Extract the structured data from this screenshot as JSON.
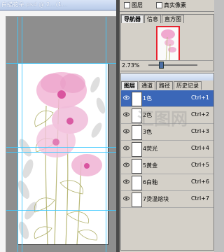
{
  "document": {
    "title": "白描花朵.psd @ 2...(1..."
  },
  "toolbar": {
    "checkbox1_label": "图层",
    "checkbox2_label": "真实像素"
  },
  "navigator": {
    "tabs": [
      "导航器",
      "信息",
      "直方图"
    ],
    "zoom": "2.73%"
  },
  "layers_panel": {
    "tabs": [
      "图层",
      "通道",
      "路径",
      "历史记录"
    ],
    "layers": [
      {
        "name": "1色",
        "shortcut": "Ctrl+1",
        "selected": true
      },
      {
        "name": "2色",
        "shortcut": "Ctrl+2",
        "selected": false
      },
      {
        "name": "3色",
        "shortcut": "Ctrl+3",
        "selected": false
      },
      {
        "name": "4荧光",
        "shortcut": "Ctrl+4",
        "selected": false
      },
      {
        "name": "5黄金",
        "shortcut": "Ctrl+5",
        "selected": false
      },
      {
        "name": "6白釉",
        "shortcut": "Ctrl+6",
        "selected": false
      },
      {
        "name": "7烫温熔块",
        "shortcut": "Ctrl+7",
        "selected": false
      }
    ]
  },
  "watermark": "汇图网",
  "colors": {
    "selected_row": "#3b67b8",
    "guides": "#3ec9ff",
    "nav_frame": "#e8212d",
    "flower_pink": "#e78fbf",
    "stem_olive": "#a7a75a"
  }
}
